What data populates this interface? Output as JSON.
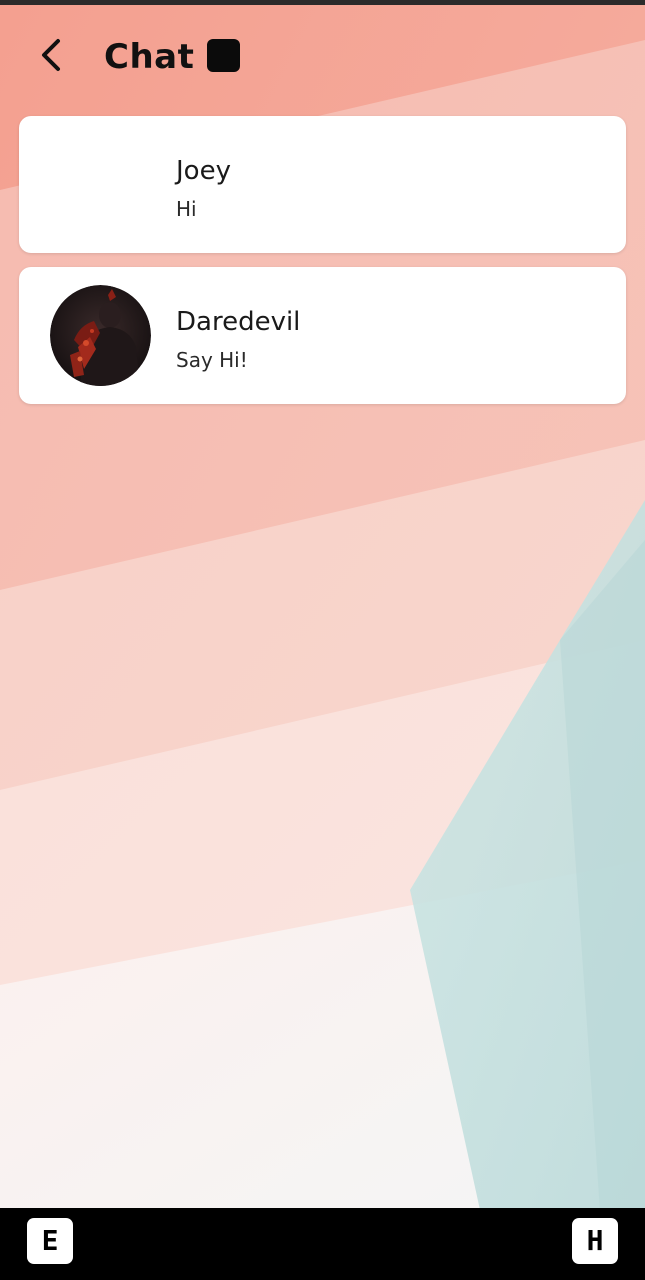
{
  "header": {
    "title": "Chat",
    "back_icon": "chevron-left-icon"
  },
  "chats": [
    {
      "name": "Joey",
      "preview": "Hi",
      "avatar": "none"
    },
    {
      "name": "Daredevil",
      "preview": "Say Hi!",
      "avatar": "daredevil-photo"
    }
  ],
  "nav": {
    "left_key": "E",
    "right_key": "H"
  },
  "colors": {
    "background_coral": "#f3a596",
    "background_peach": "#f8d2c9",
    "background_teal": "#bcdcdc",
    "card": "#ffffff",
    "nav_bar": "#000000"
  }
}
